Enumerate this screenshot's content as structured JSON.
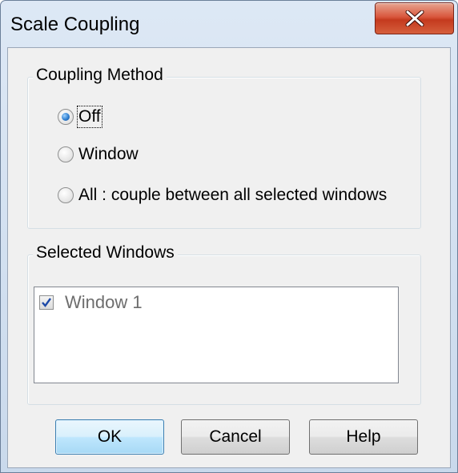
{
  "window": {
    "title": "Scale Coupling"
  },
  "coupling_method": {
    "legend": "Coupling Method",
    "options": [
      {
        "label": "Off",
        "selected": true
      },
      {
        "label": "Window",
        "selected": false
      },
      {
        "label": "All : couple between all selected windows",
        "selected": false
      }
    ]
  },
  "selected_windows": {
    "legend": "Selected Windows",
    "items": [
      {
        "label": "Window 1",
        "checked": true
      }
    ]
  },
  "buttons": {
    "ok": "OK",
    "cancel": "Cancel",
    "help": "Help"
  },
  "icons": {
    "close": "close-icon",
    "check": "checkmark-icon"
  },
  "colors": {
    "close_button": "#c43a1e",
    "default_button_border": "#3c7fb1",
    "title_bar": "#c9d9ec"
  }
}
